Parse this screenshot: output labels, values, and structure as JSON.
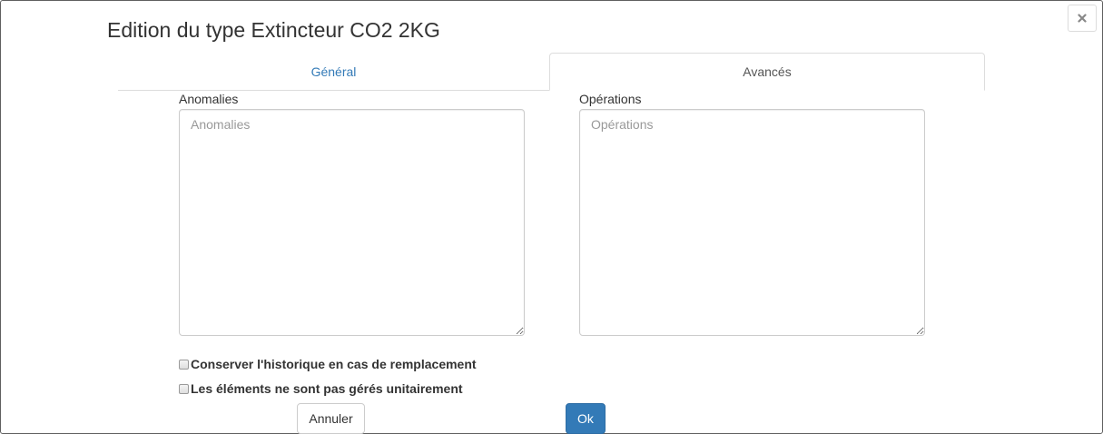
{
  "dialog": {
    "title": "Edition du type Extincteur CO2 2KG",
    "close_icon": "times-icon"
  },
  "tabs": [
    {
      "label": "Général",
      "active": false
    },
    {
      "label": "Avancés",
      "active": true
    }
  ],
  "fields": {
    "anomalies": {
      "label": "Anomalies",
      "placeholder": "Anomalies",
      "value": ""
    },
    "operations": {
      "label": "Opérations",
      "placeholder": "Opérations",
      "value": ""
    }
  },
  "checkboxes": [
    {
      "label": "Conserver l'historique en cas de remplacement",
      "checked": false
    },
    {
      "label": "Les éléments ne sont pas gérés unitairement",
      "checked": false
    }
  ],
  "buttons": {
    "cancel_label": "Annuler",
    "ok_label": "Ok"
  },
  "colors": {
    "link": "#337ab7",
    "primary": "#337ab7",
    "primary_border": "#2e6da4",
    "text": "#333333"
  }
}
